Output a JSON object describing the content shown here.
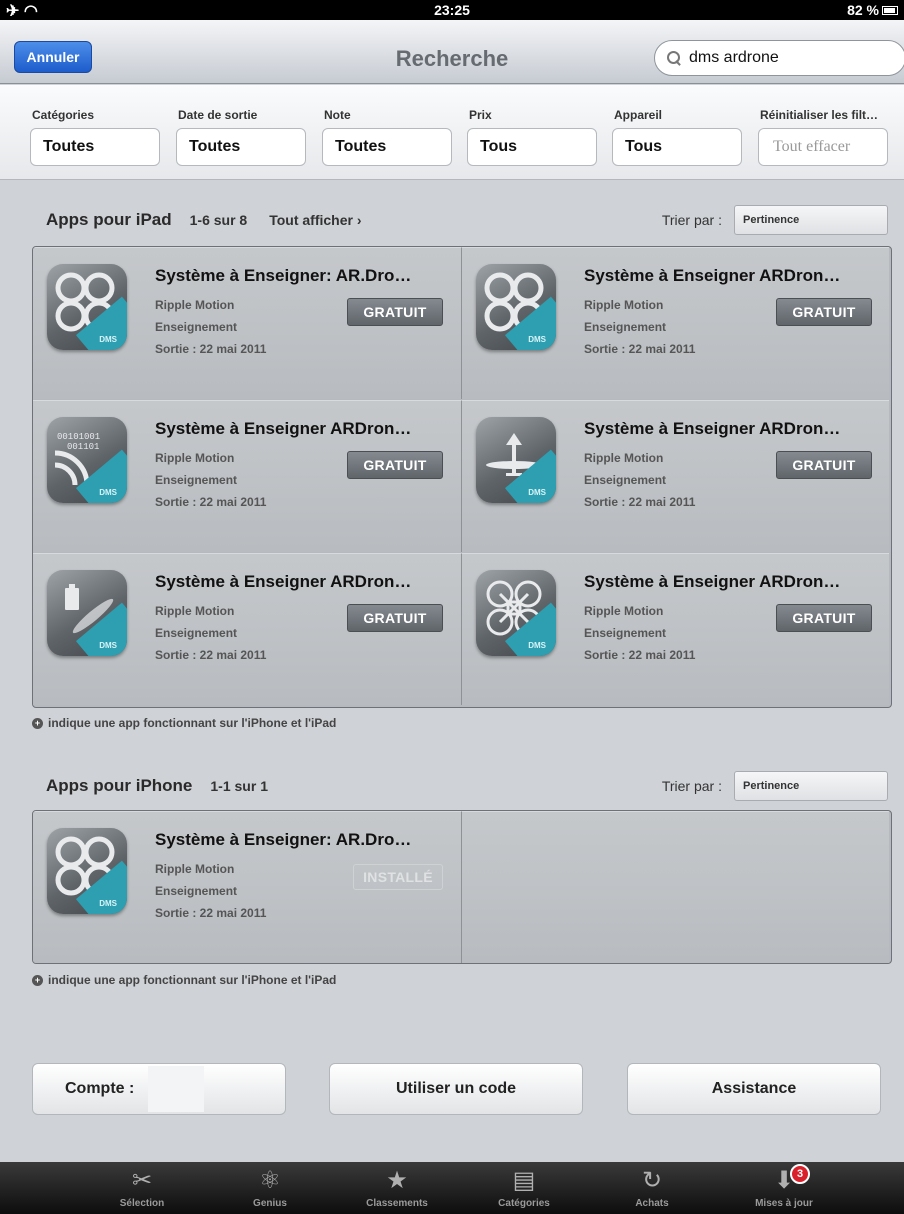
{
  "status": {
    "time": "23:25",
    "battery": "82 %"
  },
  "nav": {
    "cancel_label": "Annuler",
    "title": "Recherche",
    "search_value": "dms ardrone"
  },
  "filters": [
    {
      "label": "Catégories",
      "value": "Toutes"
    },
    {
      "label": "Date de sortie",
      "value": "Toutes"
    },
    {
      "label": "Note",
      "value": "Toutes"
    },
    {
      "label": "Prix",
      "value": "Tous"
    },
    {
      "label": "Appareil",
      "value": "Tous"
    },
    {
      "label": "Réinitialiser les filt…",
      "value": "Tout effacer"
    }
  ],
  "ipad": {
    "title": "Apps pour iPad",
    "count": "1-6 sur 8",
    "see_all": "Tout afficher ›",
    "sort_label": "Trier par :",
    "sort_value": "Pertinence",
    "apps": [
      {
        "name": "Système à Enseigner: AR.Dro…",
        "developer": "Ripple Motion",
        "category": "Enseignement",
        "release": "Sortie : 22 mai 2011",
        "price": "GRATUIT",
        "icon": "drone-outline-icon"
      },
      {
        "name": "Système à Enseigner ARDron…",
        "developer": "Ripple Motion",
        "category": "Enseignement",
        "release": "Sortie : 22 mai 2011",
        "price": "GRATUIT",
        "icon": "drone-outline-icon"
      },
      {
        "name": "Système à Enseigner ARDron…",
        "developer": "Ripple Motion",
        "category": "Enseignement",
        "release": "Sortie : 22 mai 2011",
        "price": "GRATUIT",
        "icon": "binary-wifi-icon"
      },
      {
        "name": "Système à Enseigner ARDron…",
        "developer": "Ripple Motion",
        "category": "Enseignement",
        "release": "Sortie : 22 mai 2011",
        "price": "GRATUIT",
        "icon": "propeller-arrow-icon"
      },
      {
        "name": "Système à Enseigner ARDron…",
        "developer": "Ripple Motion",
        "category": "Enseignement",
        "release": "Sortie : 22 mai 2011",
        "price": "GRATUIT",
        "icon": "battery-propeller-icon"
      },
      {
        "name": "Système à Enseigner ARDron…",
        "developer": "Ripple Motion",
        "category": "Enseignement",
        "release": "Sortie : 22 mai 2011",
        "price": "GRATUIT",
        "icon": "drone-frame-icon"
      }
    ],
    "note": "indique une app fonctionnant sur l'iPhone et l'iPad"
  },
  "iphone": {
    "title": "Apps pour iPhone",
    "count": "1-1 sur 1",
    "sort_label": "Trier par :",
    "sort_value": "Pertinence",
    "apps": [
      {
        "name": "Système à Enseigner: AR.Dro…",
        "developer": "Ripple Motion",
        "category": "Enseignement",
        "release": "Sortie : 22 mai 2011",
        "price": "INSTALLÉ",
        "icon": "drone-outline-icon"
      }
    ],
    "note": "indique une app fonctionnant sur l'iPhone et l'iPad"
  },
  "footer": {
    "account_label": "Compte :",
    "redeem_label": "Utiliser un code",
    "support_label": "Assistance"
  },
  "tabs": [
    {
      "label": "Sélection",
      "icon": "selection-icon"
    },
    {
      "label": "Genius",
      "icon": "atom-icon"
    },
    {
      "label": "Classements",
      "icon": "star-icon"
    },
    {
      "label": "Catégories",
      "icon": "stack-icon"
    },
    {
      "label": "Achats",
      "icon": "purchases-icon"
    },
    {
      "label": "Mises à jour",
      "icon": "updates-icon",
      "badge": "3"
    }
  ]
}
